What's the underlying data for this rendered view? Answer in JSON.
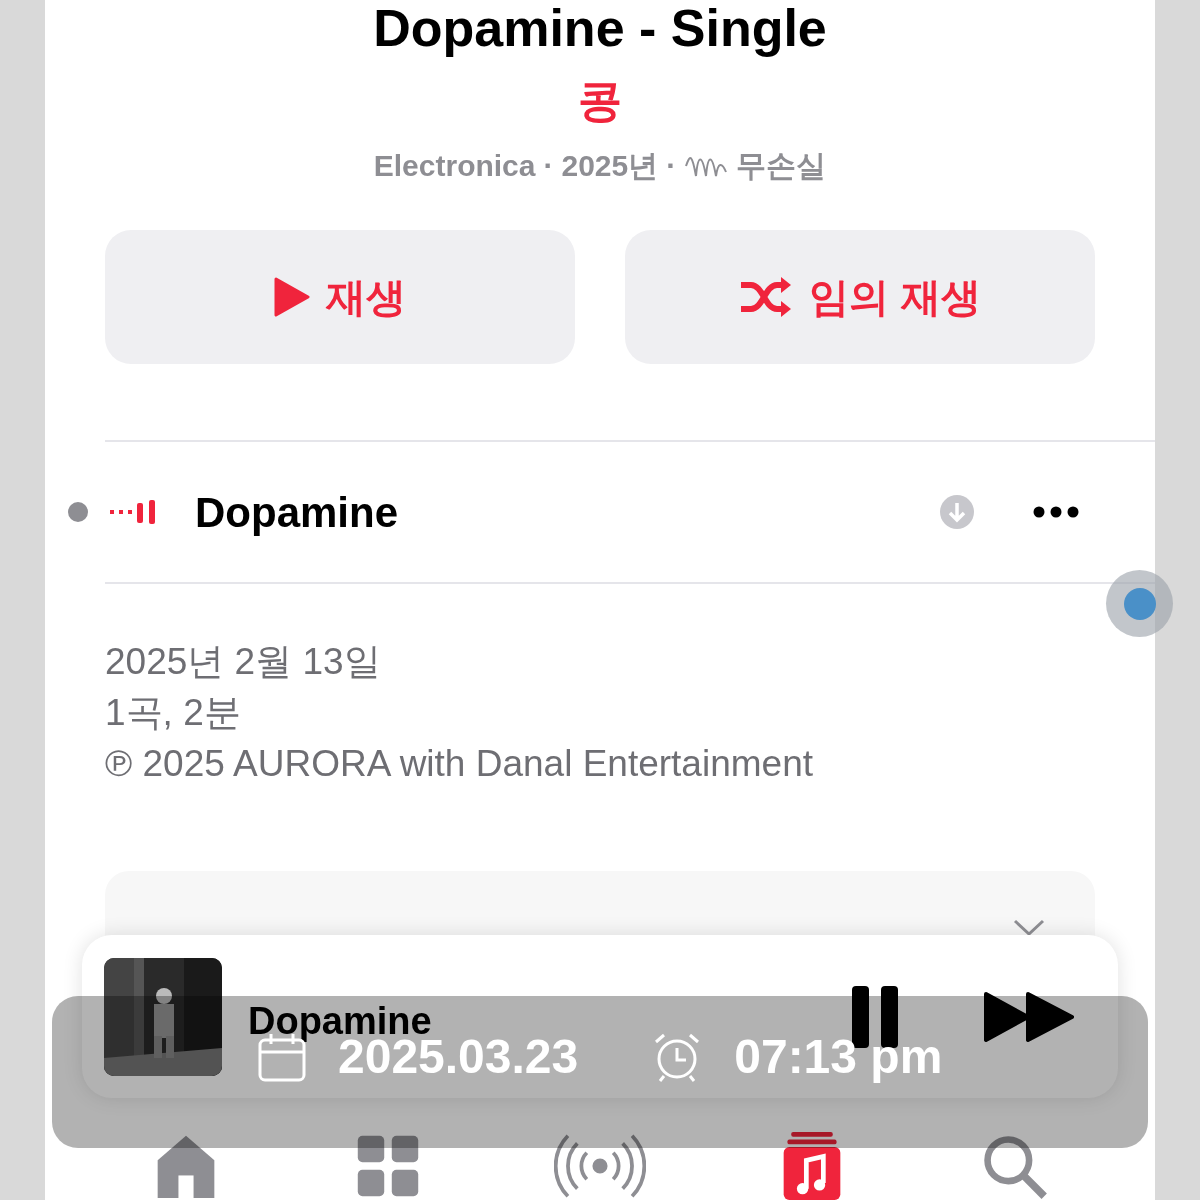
{
  "album": {
    "title": "Dopamine - Single",
    "artist": "콩",
    "meta": [
      "Electronica",
      "·",
      "2025년",
      "·"
    ],
    "lossless": "무손실"
  },
  "buttons": [
    {
      "kind": "play",
      "label": "재생"
    },
    {
      "kind": "shuffle",
      "label": "임의 재생"
    }
  ],
  "tracks": [
    {
      "title": "Dopamine",
      "playing": true
    }
  ],
  "info": [
    "2025년 2월 13일",
    "1곡, 2분",
    "℗ 2025 AURORA with Danal Entertainment"
  ],
  "mini_player": {
    "title": "Dopamine",
    "playing": true
  },
  "stamp": {
    "date": "2025.03.23",
    "time": "07:13 pm"
  },
  "tab_bar": [
    {
      "kind": "home",
      "selected": false
    },
    {
      "kind": "browse",
      "selected": false
    },
    {
      "kind": "radio",
      "selected": false
    },
    {
      "kind": "library",
      "selected": true
    },
    {
      "kind": "search",
      "selected": false
    }
  ]
}
